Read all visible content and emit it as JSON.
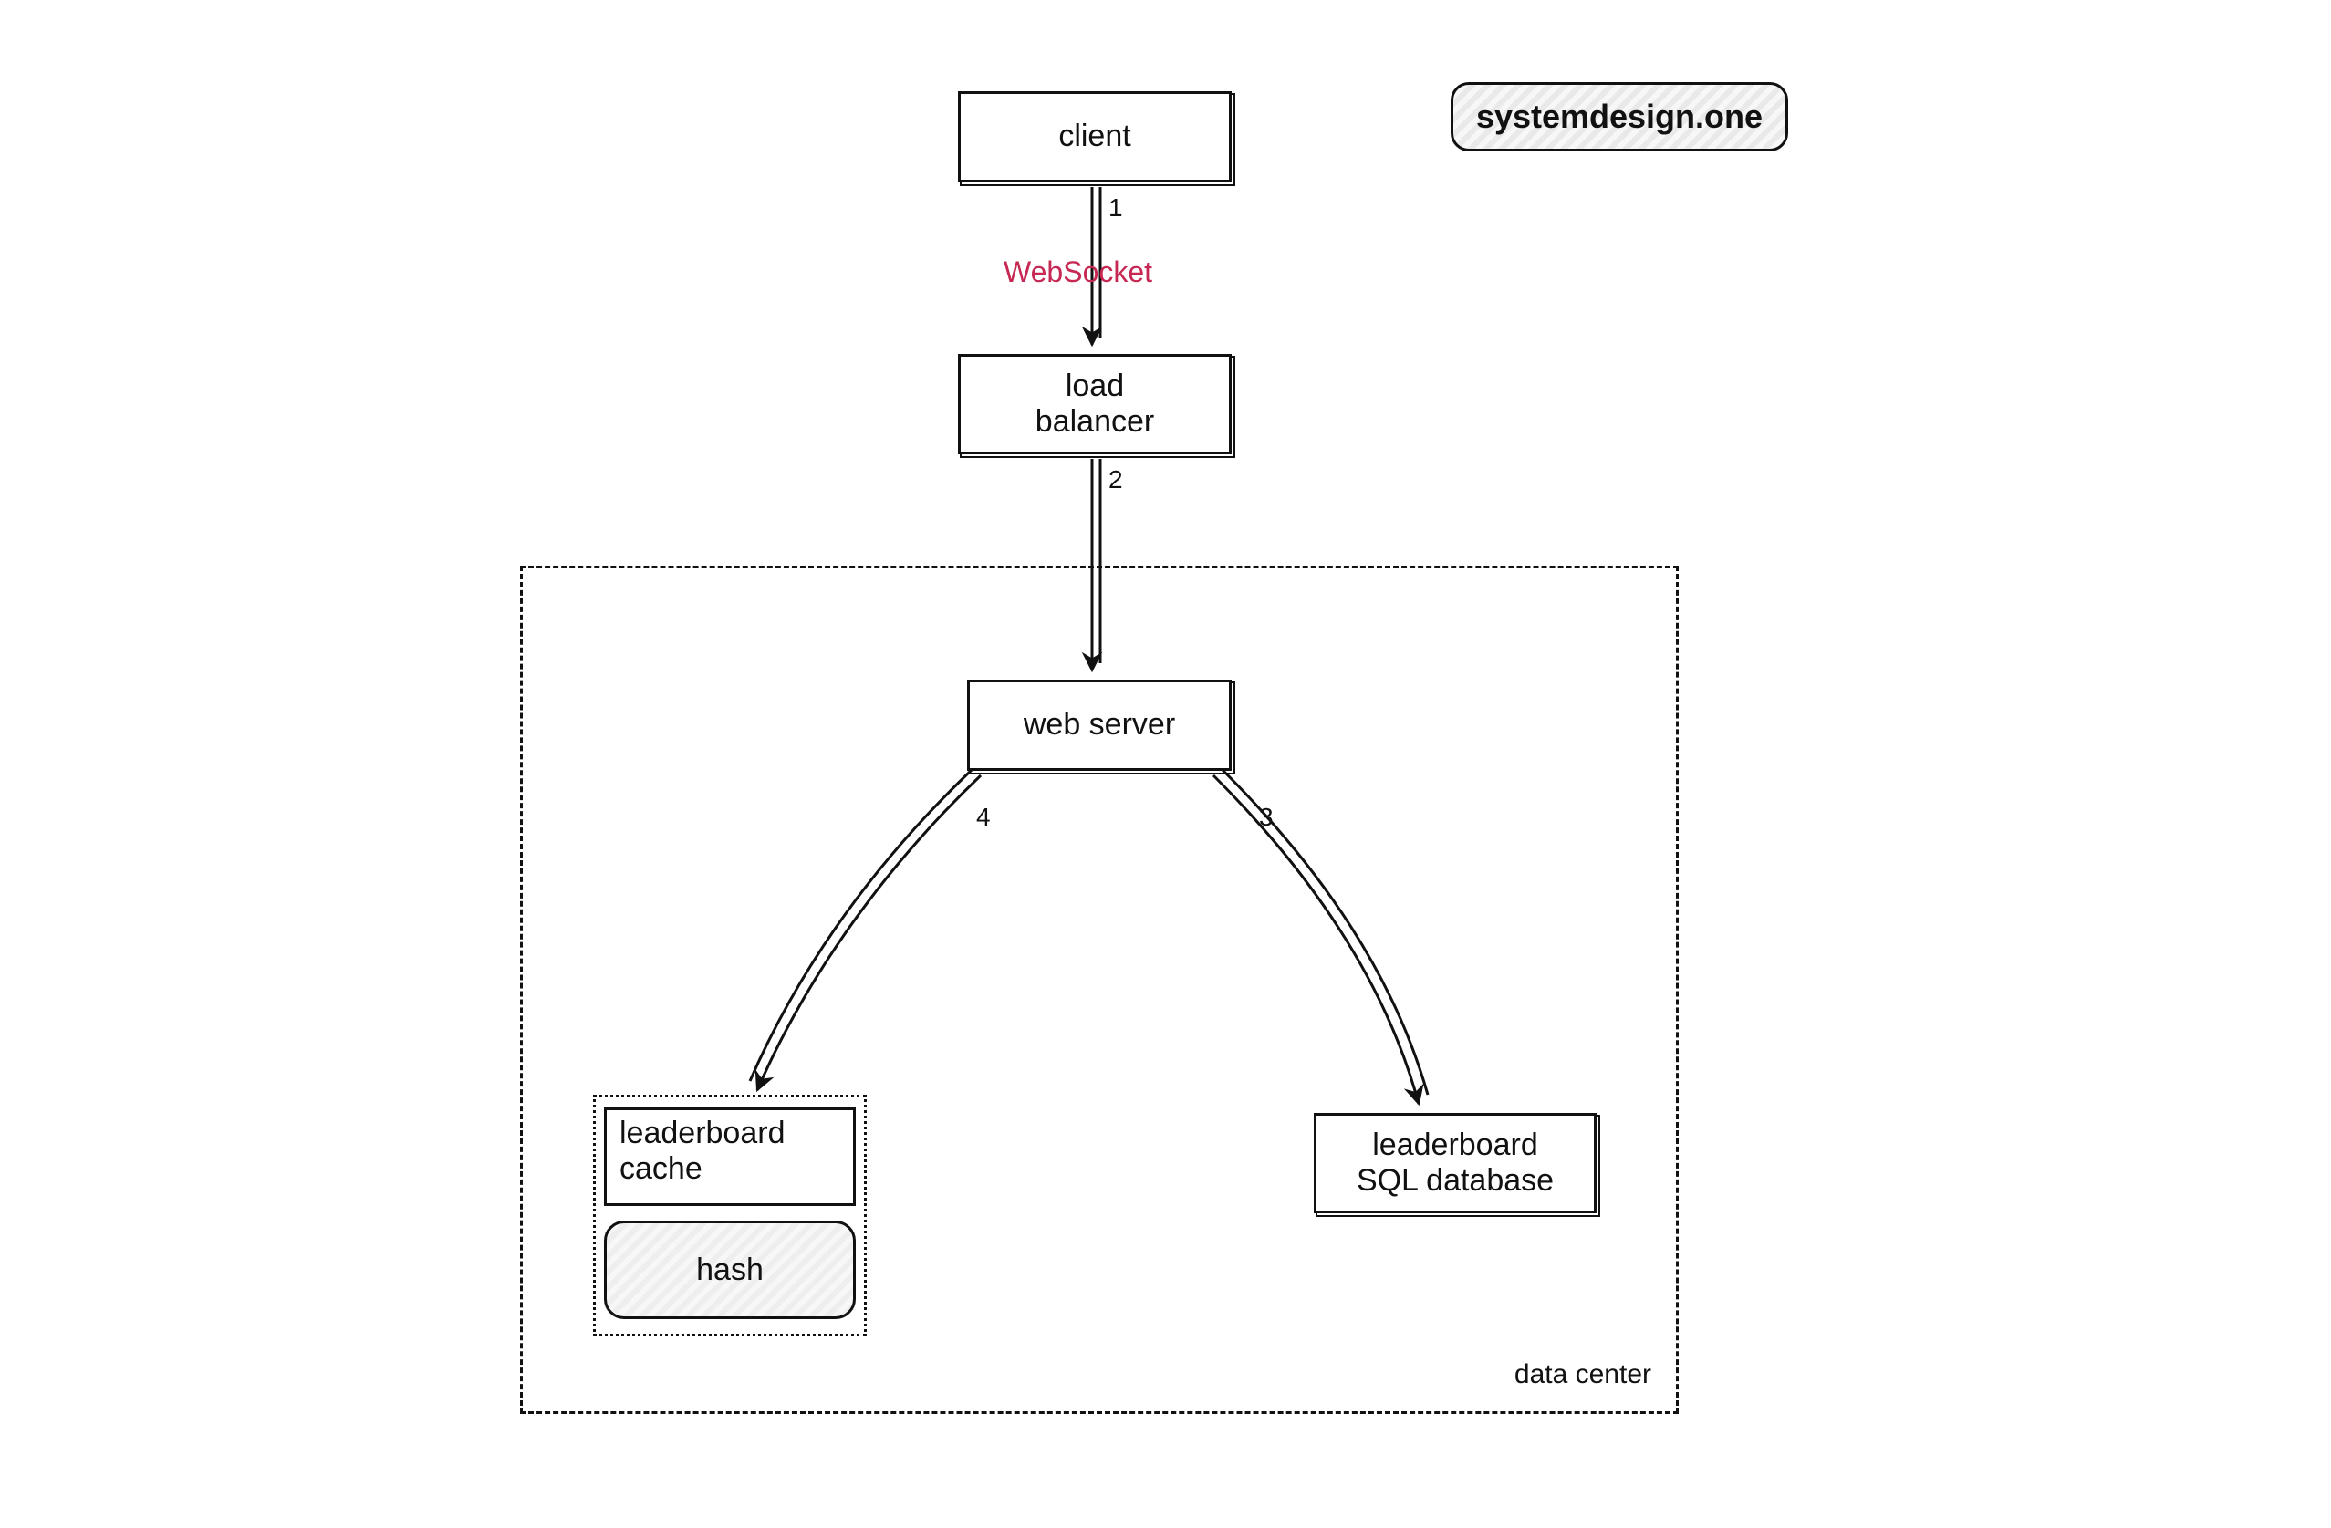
{
  "watermark": "systemdesign.one",
  "nodes": {
    "client": "client",
    "load_balancer": "load\nbalancer",
    "web_server": "web server",
    "leaderboard_cache": "leaderboard\ncache",
    "hash": "hash",
    "leaderboard_sql": "leaderboard\nSQL database"
  },
  "region": {
    "data_center": "data center"
  },
  "edges": {
    "e1": {
      "step": "1",
      "label": "WebSocket"
    },
    "e2": {
      "step": "2"
    },
    "e3": {
      "step": "3"
    },
    "e4": {
      "step": "4"
    }
  }
}
